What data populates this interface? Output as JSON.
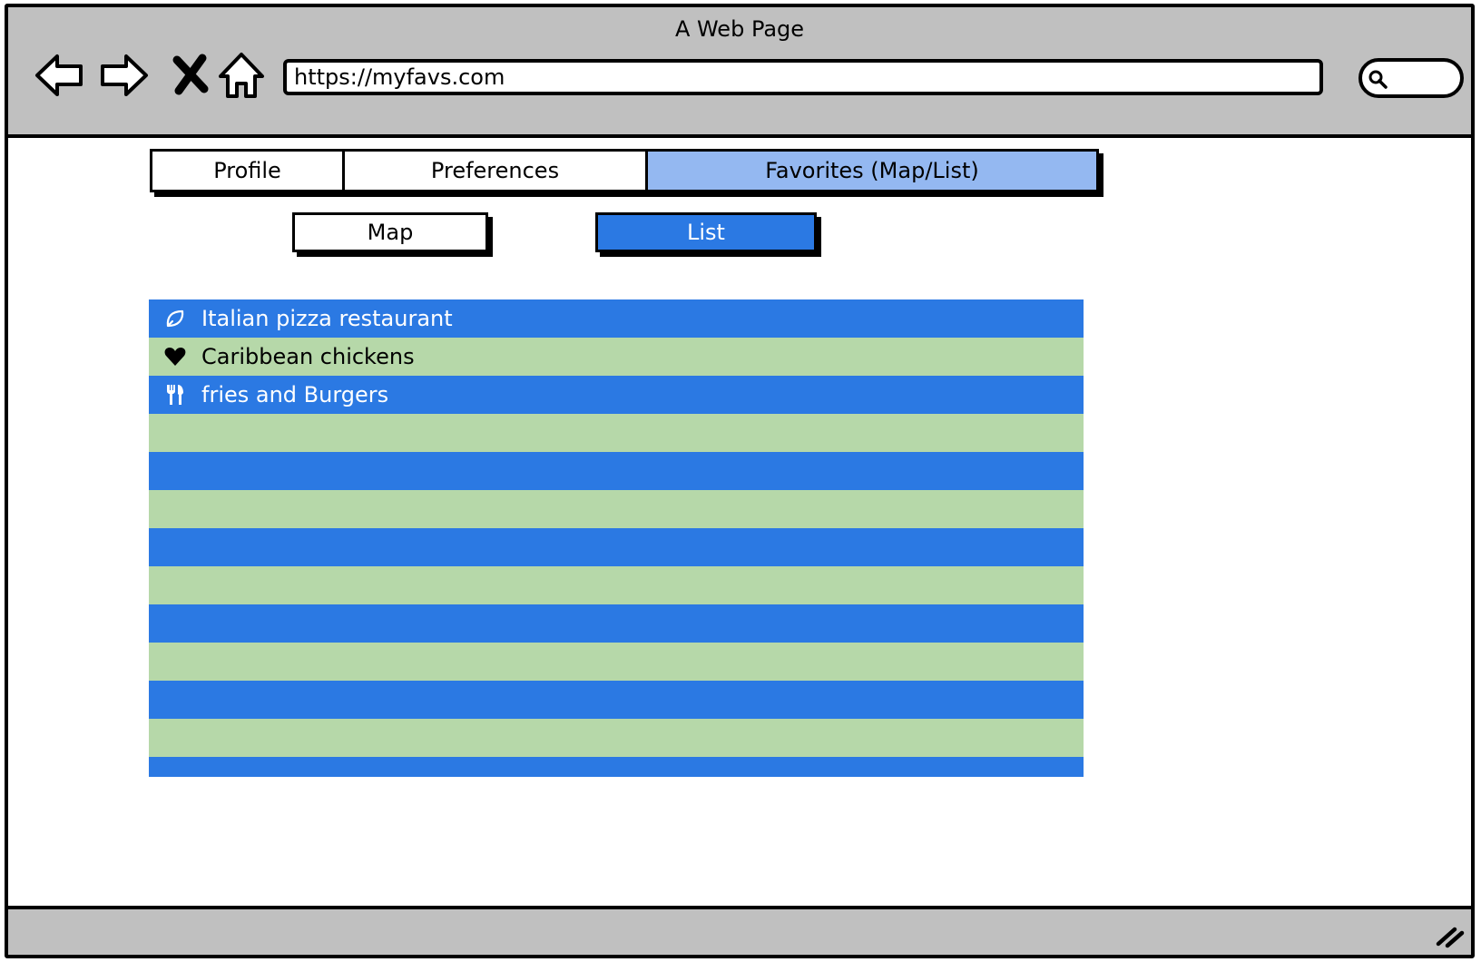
{
  "window": {
    "title": "A Web Page"
  },
  "browser": {
    "url": "https://myfavs.com",
    "icons": {
      "back": "back-arrow-icon",
      "forward": "forward-arrow-icon",
      "stop": "close-icon",
      "home": "home-icon",
      "search": "search-icon"
    }
  },
  "tabs": [
    {
      "label": "Profile",
      "active": false
    },
    {
      "label": "Preferences",
      "active": false
    },
    {
      "label": "Favorites (Map/List)",
      "active": true
    }
  ],
  "view_toggle": {
    "map_label": "Map",
    "list_label": "List",
    "selected": "List"
  },
  "favorites": [
    {
      "label": "Italian pizza restaurant",
      "icon": "leaf-icon"
    },
    {
      "label": "Caribbean chickens",
      "icon": "heart-icon"
    },
    {
      "label": "fries and Burgers",
      "icon": "cutlery-icon"
    }
  ],
  "colors": {
    "chrome_gray": "#c0c0c0",
    "active_tab": "#94b8f1",
    "primary_blue": "#2b79e3",
    "row_green": "#b6d8a9"
  }
}
